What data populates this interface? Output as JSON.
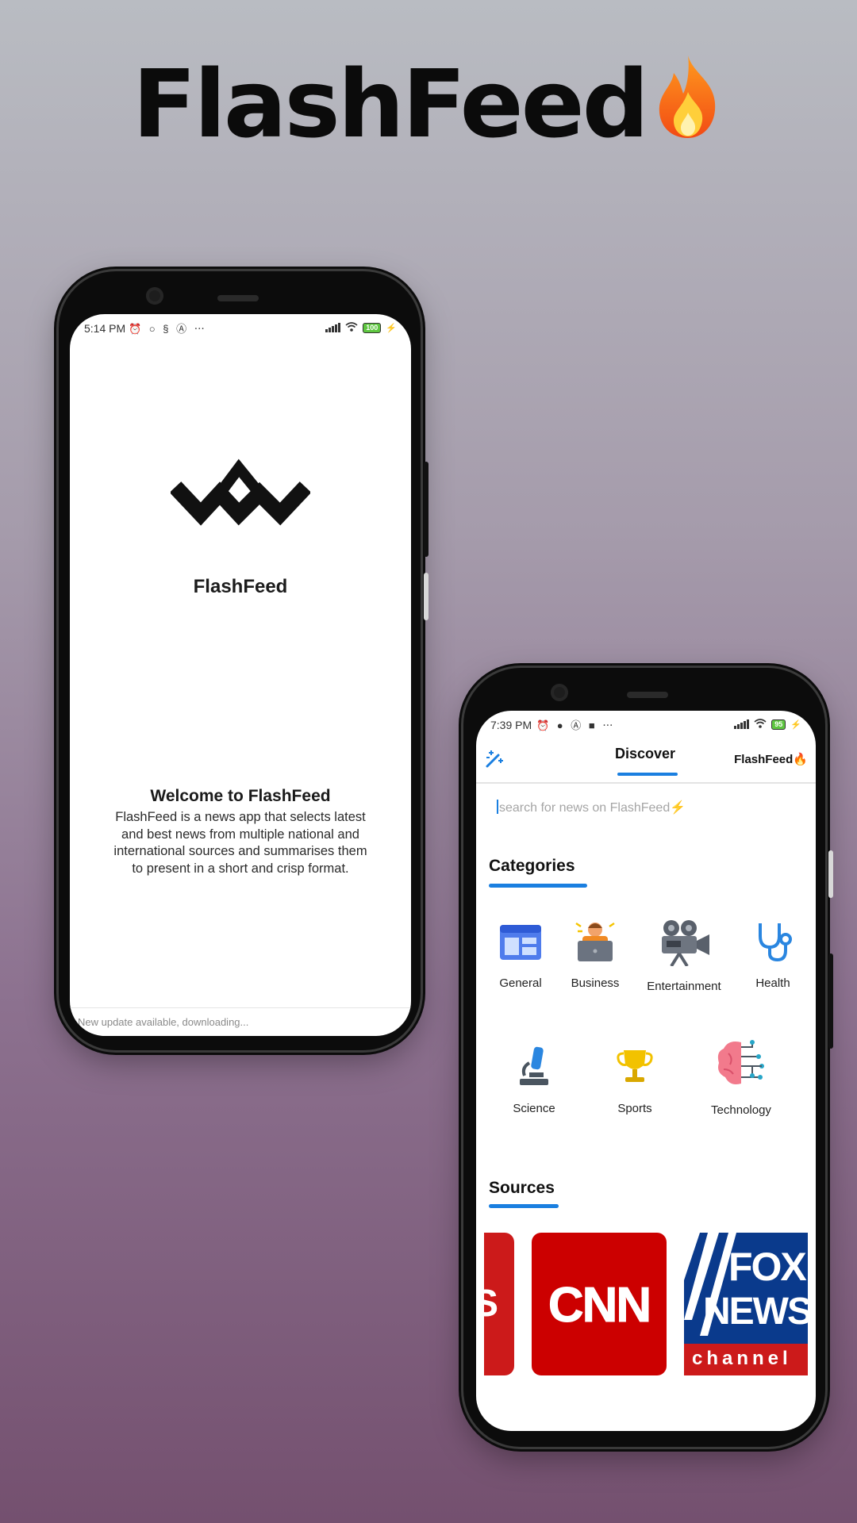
{
  "headline": {
    "title": "FlashFeed",
    "emoji_icon": "fire-icon"
  },
  "phone1": {
    "status": {
      "time": "5:14 PM",
      "icons": "⏰ ○ § Ⓐ ⋯",
      "battery": "100"
    },
    "logo_icon": "flashfeed-logo-icon",
    "app_name": "FlashFeed",
    "welcome_title": "Welcome to FlashFeed",
    "welcome_body": "FlashFeed is a news app that selects latest and best news from multiple national and international sources and summarises them to present in a short and crisp format.",
    "update_text": "New update available, downloading..."
  },
  "phone2": {
    "status": {
      "time": "7:39 PM",
      "icons": "⏰ ● Ⓐ ■ ⋯",
      "battery": "95"
    },
    "nav": {
      "discover": "Discover",
      "flashfeed": "FlashFeed🔥"
    },
    "search_placeholder": "search for news on FlashFeed⚡",
    "categories_title": "Categories",
    "categories": [
      {
        "label": "General",
        "icon": "newspaper-icon"
      },
      {
        "label": "Business",
        "icon": "business-laptop-icon"
      },
      {
        "label": "Entertainment",
        "icon": "movie-camera-icon"
      },
      {
        "label": "Health",
        "icon": "stethoscope-icon"
      },
      {
        "label": "Science",
        "icon": "microscope-icon"
      },
      {
        "label": "Sports",
        "icon": "trophy-icon"
      },
      {
        "label": "Technology",
        "icon": "brain-circuit-icon"
      }
    ],
    "sources_title": "Sources",
    "sources": [
      {
        "text": "S"
      },
      {
        "text": "CNN"
      },
      {
        "text_line1": "FOX",
        "text_line2": "NEWS",
        "text_line3": "channel"
      }
    ]
  },
  "colors": {
    "accent": "#1a7fe0",
    "cnn_red": "#cc0000",
    "fox_blue": "#0a3a8c"
  }
}
